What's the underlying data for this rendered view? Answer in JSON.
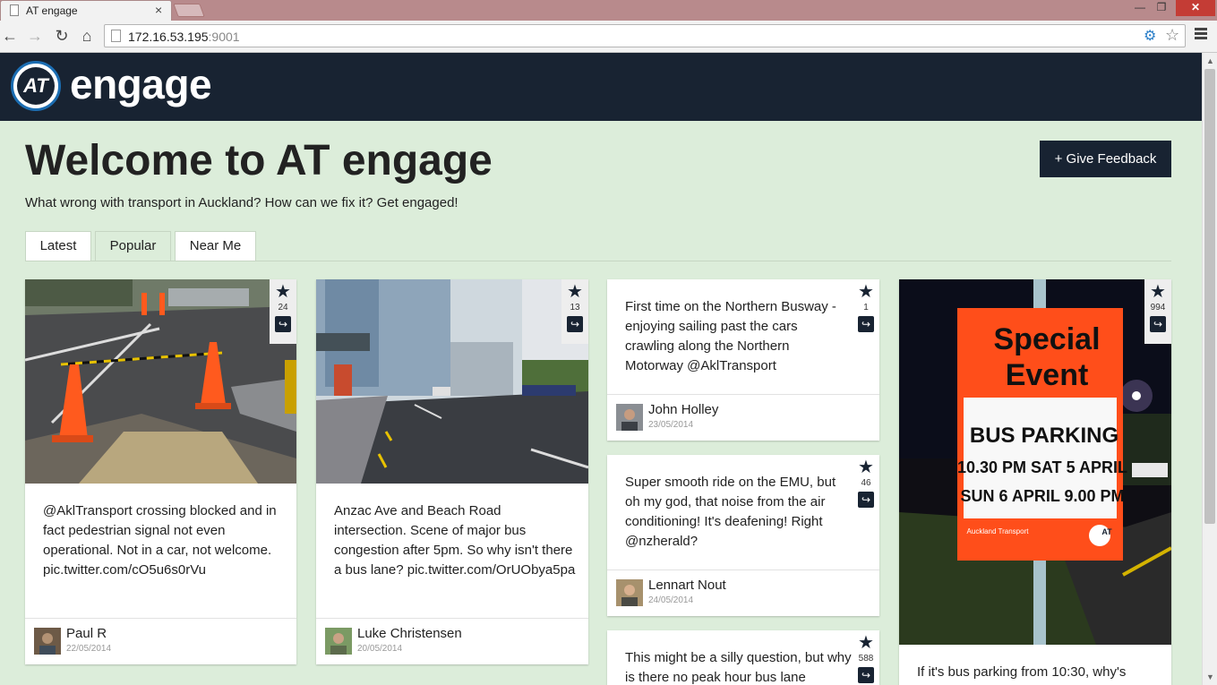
{
  "browser": {
    "tab_title": "AT engage",
    "tab_close": "×",
    "url_host": "172.16.53.195",
    "url_port": ":9001",
    "window_controls": {
      "minimize": "—",
      "maximize": "❐",
      "close": "✕"
    },
    "nav": {
      "back": "←",
      "forward": "→",
      "reload": "↻",
      "home": "⌂"
    },
    "icons": {
      "extension": "⚙",
      "bookmark": "☆"
    }
  },
  "site": {
    "logo_text": "AT",
    "brand": "engage",
    "brand_colors": {
      "header_bg": "#182332",
      "page_bg": "#dcedda",
      "logo_ring": "#1b6db2"
    }
  },
  "page": {
    "title": "Welcome to AT engage",
    "subtitle": "What wrong with transport in Auckland? How can we fix it? Get engaged!",
    "feedback_button": "+ Give Feedback",
    "tabs": [
      {
        "label": "Latest"
      },
      {
        "label": "Popular"
      },
      {
        "label": "Near Me"
      }
    ]
  },
  "icons": {
    "star": "★",
    "share": "↪"
  },
  "cards": [
    {
      "count": "24",
      "text": "@AklTransport crossing blocked and in fact pedestrian signal not even operational. Not in a car, not welcome. pic.twitter.com/cO5u6s0rVu",
      "author": "Paul R",
      "date": "22/05/2014"
    },
    {
      "count": "13",
      "text": "Anzac Ave and Beach Road intersection. Scene of major bus congestion after 5pm. So why isn't there a bus lane? pic.twitter.com/OrUObya5pa",
      "author": "Luke Christensen",
      "date": "20/05/2014"
    },
    {
      "count": "1",
      "text": "First time on the Northern Busway - enjoying sailing past the cars crawling along the Northern Motorway @AklTransport",
      "author": "John Holley",
      "date": "23/05/2014"
    },
    {
      "count": "46",
      "text": "Super smooth ride on the EMU, but oh my god, that noise from the air conditioning! It's deafening! Right @nzherald?",
      "author": "Lennart Nout",
      "date": "24/05/2014"
    },
    {
      "count": "588",
      "text": "This might be a silly question, but why is there no peak hour bus lane"
    },
    {
      "count": "994",
      "text": "If it's bus parking from 10:30, why's",
      "sign": {
        "line1": "Special",
        "line2": "Event",
        "line3": "BUS PARKING",
        "line4": "10.30 PM SAT 5 APRIL",
        "line5": "SUN 6 APRIL 9.00 PM",
        "brand": "Auckland Transport",
        "logo": "AT"
      }
    }
  ]
}
